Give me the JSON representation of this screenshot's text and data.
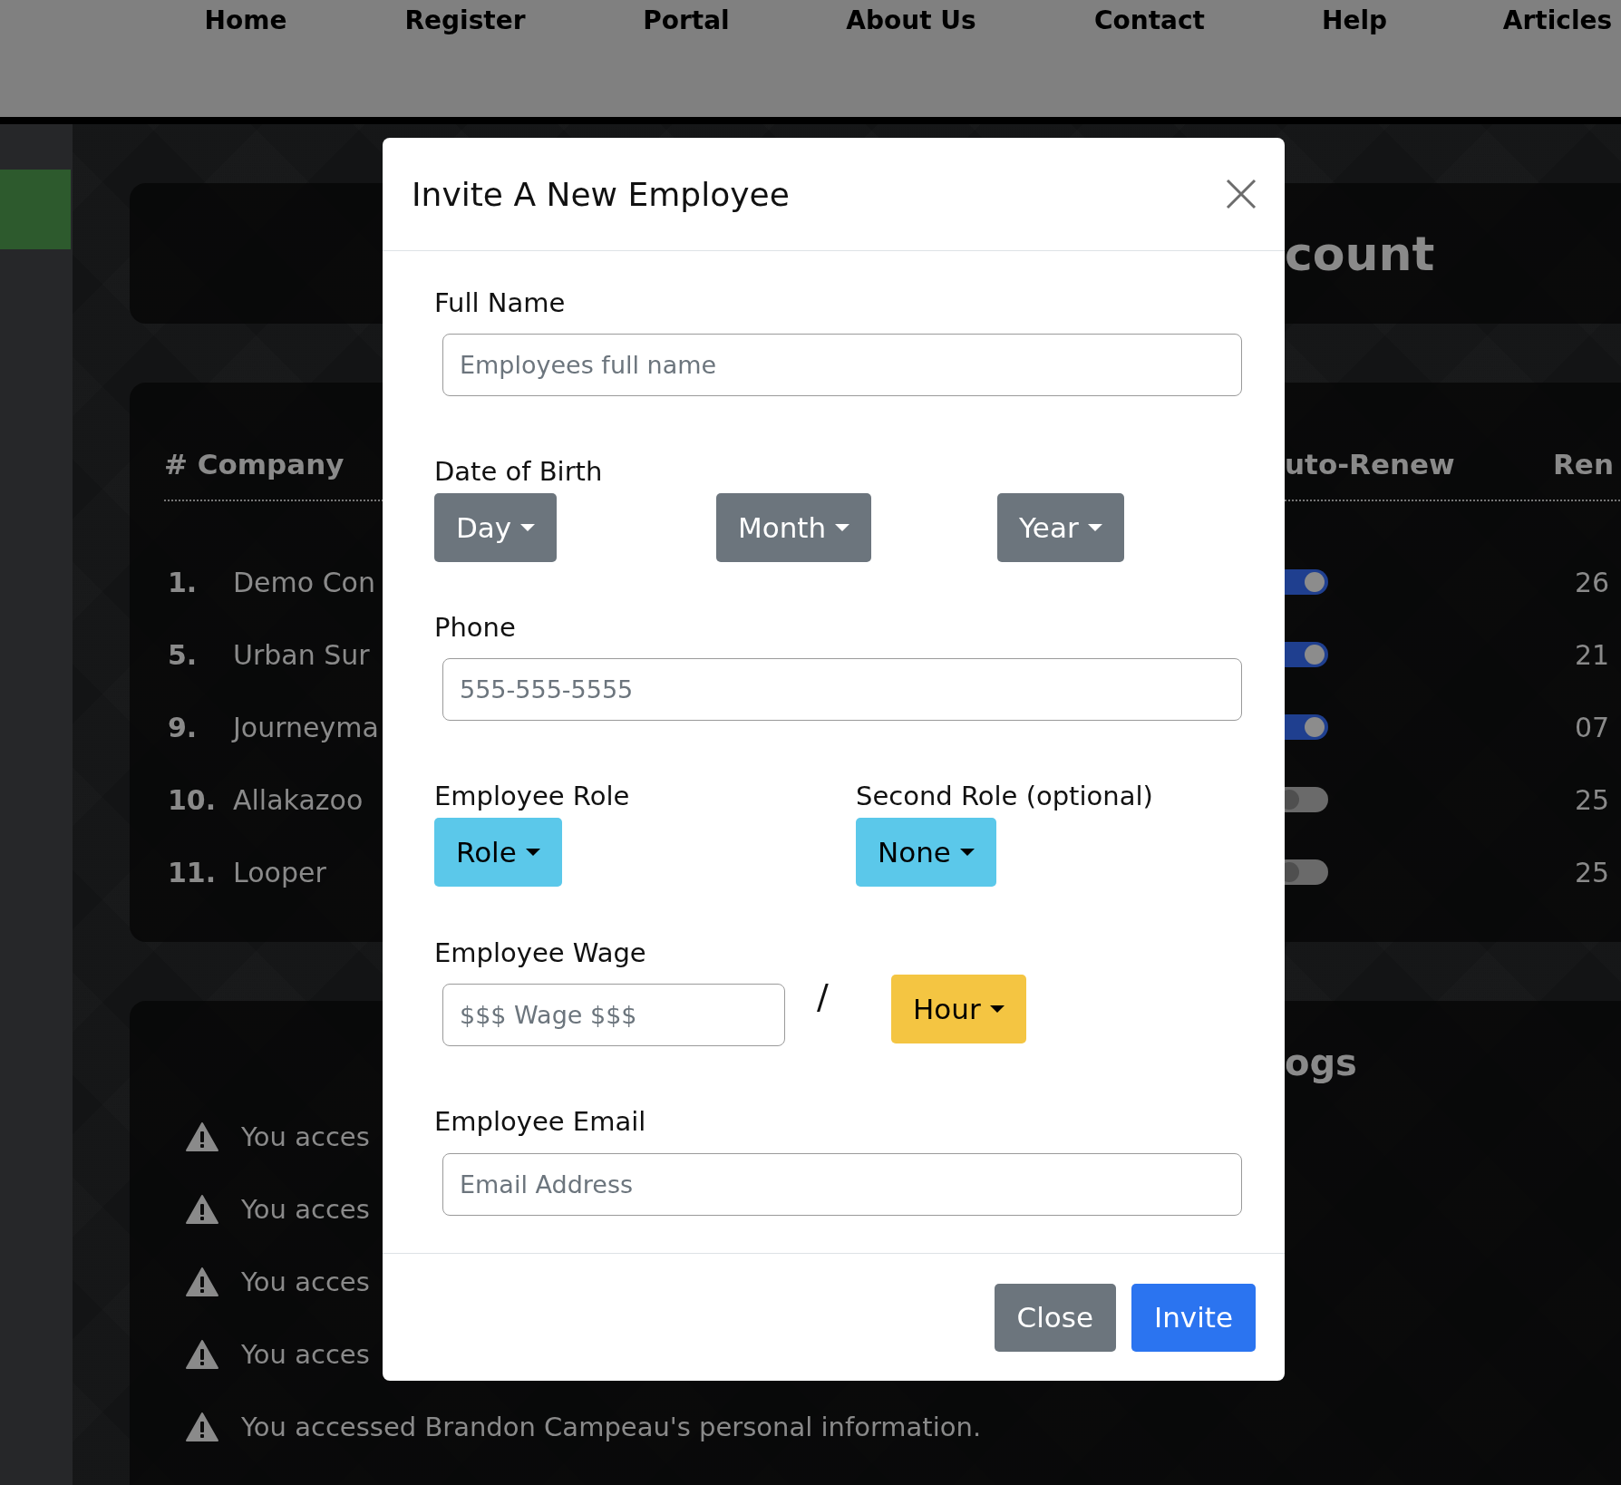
{
  "nav": [
    "Home",
    "Register",
    "Portal",
    "About Us",
    "Contact",
    "Help",
    "Articles"
  ],
  "background": {
    "title_fragment": "count",
    "table": {
      "header_left": "# Company",
      "header_right": "uto-Renew",
      "header_edge": "Ren",
      "rows": [
        {
          "number": "1.",
          "name": "Demo Con",
          "auto_renew": true,
          "value": "26"
        },
        {
          "number": "5.",
          "name": "Urban Sur",
          "auto_renew": true,
          "value": "21"
        },
        {
          "number": "9.",
          "name": "Journeyma",
          "auto_renew": true,
          "value": "07"
        },
        {
          "number": "10.",
          "name": "Allakazoo",
          "auto_renew": false,
          "value": "25"
        },
        {
          "number": "11.",
          "name": "Looper",
          "auto_renew": false,
          "value": "25"
        }
      ]
    },
    "logs": {
      "title_fragment": "ogs",
      "entries": [
        "You acces",
        "You acces",
        "You acces",
        "You acces"
      ],
      "full_entry": "You accessed Brandon Campeau's personal information."
    }
  },
  "modal": {
    "title": "Invite A New Employee",
    "full_name": {
      "label": "Full Name",
      "placeholder": "Employees full name"
    },
    "date_of_birth": {
      "label": "Date of Birth",
      "dropdowns": [
        {
          "label": "Day",
          "kind": "secondary"
        },
        {
          "label": "Month",
          "kind": "secondary"
        },
        {
          "label": "Year",
          "kind": "secondary"
        }
      ]
    },
    "phone": {
      "label": "Phone",
      "placeholder": "555-555-5555"
    },
    "roles": [
      {
        "label": "Employee Role",
        "button": "Role",
        "kind": "info"
      },
      {
        "label": "Second Role (optional)",
        "button": "None",
        "kind": "info"
      }
    ],
    "wage": {
      "label": "Employee Wage",
      "placeholder": "$$$ Wage $$$",
      "separator": "/",
      "unit": "Hour",
      "kind": "warning"
    },
    "email": {
      "label": "Employee Email",
      "placeholder": "Email Address"
    },
    "buttons": [
      {
        "label": "Close",
        "kind": "secondary"
      },
      {
        "label": "Invite",
        "kind": "primary"
      }
    ]
  }
}
